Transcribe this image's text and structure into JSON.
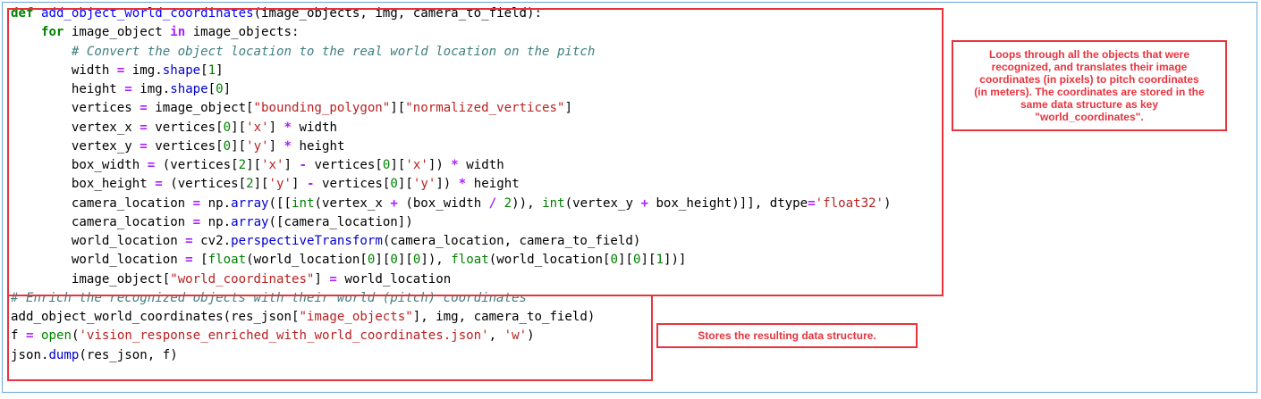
{
  "code_lines": [
    [
      {
        "t": "def",
        "c": "kw"
      },
      {
        "t": " "
      },
      {
        "t": "add_object_world_coordinates",
        "c": "fn"
      },
      {
        "t": "(image_objects, img, camera_to_field):"
      }
    ],
    [
      {
        "t": "    "
      },
      {
        "t": "for",
        "c": "kw"
      },
      {
        "t": " image_object "
      },
      {
        "t": "in",
        "c": "op"
      },
      {
        "t": " image_objects:"
      }
    ],
    [
      {
        "t": "        "
      },
      {
        "t": "# Convert the object location to the real world location on the pitch",
        "c": "cm"
      }
    ],
    [
      {
        "t": "        width "
      },
      {
        "t": "=",
        "c": "op"
      },
      {
        "t": " img."
      },
      {
        "t": "shape",
        "c": "attr"
      },
      {
        "t": "["
      },
      {
        "t": "1",
        "c": "nm"
      },
      {
        "t": "]"
      }
    ],
    [
      {
        "t": "        height "
      },
      {
        "t": "=",
        "c": "op"
      },
      {
        "t": " img."
      },
      {
        "t": "shape",
        "c": "attr"
      },
      {
        "t": "["
      },
      {
        "t": "0",
        "c": "nm"
      },
      {
        "t": "]"
      }
    ],
    [
      {
        "t": "        vertices "
      },
      {
        "t": "=",
        "c": "op"
      },
      {
        "t": " image_object["
      },
      {
        "t": "\"bounding_polygon\"",
        "c": "str"
      },
      {
        "t": "]["
      },
      {
        "t": "\"normalized_vertices\"",
        "c": "str"
      },
      {
        "t": "]"
      }
    ],
    [
      {
        "t": "        vertex_x "
      },
      {
        "t": "=",
        "c": "op"
      },
      {
        "t": " vertices["
      },
      {
        "t": "0",
        "c": "nm"
      },
      {
        "t": "]["
      },
      {
        "t": "'x'",
        "c": "str"
      },
      {
        "t": "] "
      },
      {
        "t": "*",
        "c": "op"
      },
      {
        "t": " width"
      }
    ],
    [
      {
        "t": "        vertex_y "
      },
      {
        "t": "=",
        "c": "op"
      },
      {
        "t": " vertices["
      },
      {
        "t": "0",
        "c": "nm"
      },
      {
        "t": "]["
      },
      {
        "t": "'y'",
        "c": "str"
      },
      {
        "t": "] "
      },
      {
        "t": "*",
        "c": "op"
      },
      {
        "t": " height"
      }
    ],
    [
      {
        "t": "        box_width "
      },
      {
        "t": "=",
        "c": "op"
      },
      {
        "t": " (vertices["
      },
      {
        "t": "2",
        "c": "nm"
      },
      {
        "t": "]["
      },
      {
        "t": "'x'",
        "c": "str"
      },
      {
        "t": "] "
      },
      {
        "t": "-",
        "c": "op"
      },
      {
        "t": " vertices["
      },
      {
        "t": "0",
        "c": "nm"
      },
      {
        "t": "]["
      },
      {
        "t": "'x'",
        "c": "str"
      },
      {
        "t": "]) "
      },
      {
        "t": "*",
        "c": "op"
      },
      {
        "t": " width"
      }
    ],
    [
      {
        "t": "        box_height "
      },
      {
        "t": "=",
        "c": "op"
      },
      {
        "t": " (vertices["
      },
      {
        "t": "2",
        "c": "nm"
      },
      {
        "t": "]["
      },
      {
        "t": "'y'",
        "c": "str"
      },
      {
        "t": "] "
      },
      {
        "t": "-",
        "c": "op"
      },
      {
        "t": " vertices["
      },
      {
        "t": "0",
        "c": "nm"
      },
      {
        "t": "]["
      },
      {
        "t": "'y'",
        "c": "str"
      },
      {
        "t": "]) "
      },
      {
        "t": "*",
        "c": "op"
      },
      {
        "t": " height"
      }
    ],
    [
      {
        "t": "        camera_location "
      },
      {
        "t": "=",
        "c": "op"
      },
      {
        "t": " np."
      },
      {
        "t": "array",
        "c": "attr"
      },
      {
        "t": "([["
      },
      {
        "t": "int",
        "c": "nm"
      },
      {
        "t": "(vertex_x "
      },
      {
        "t": "+",
        "c": "op"
      },
      {
        "t": " (box_width "
      },
      {
        "t": "/",
        "c": "op"
      },
      {
        "t": " "
      },
      {
        "t": "2",
        "c": "nm"
      },
      {
        "t": ")), "
      },
      {
        "t": "int",
        "c": "nm"
      },
      {
        "t": "(vertex_y "
      },
      {
        "t": "+",
        "c": "op"
      },
      {
        "t": " box_height)]], dtype"
      },
      {
        "t": "=",
        "c": "op"
      },
      {
        "t": "'float32'",
        "c": "str"
      },
      {
        "t": ")"
      }
    ],
    [
      {
        "t": "        camera_location "
      },
      {
        "t": "=",
        "c": "op"
      },
      {
        "t": " np."
      },
      {
        "t": "array",
        "c": "attr"
      },
      {
        "t": "([camera_location])"
      }
    ],
    [
      {
        "t": "        world_location "
      },
      {
        "t": "=",
        "c": "op"
      },
      {
        "t": " cv2."
      },
      {
        "t": "perspectiveTransform",
        "c": "attr"
      },
      {
        "t": "(camera_location, camera_to_field)"
      }
    ],
    [
      {
        "t": "        world_location "
      },
      {
        "t": "=",
        "c": "op"
      },
      {
        "t": " ["
      },
      {
        "t": "float",
        "c": "nm"
      },
      {
        "t": "(world_location["
      },
      {
        "t": "0",
        "c": "nm"
      },
      {
        "t": "]["
      },
      {
        "t": "0",
        "c": "nm"
      },
      {
        "t": "]["
      },
      {
        "t": "0",
        "c": "nm"
      },
      {
        "t": "]), "
      },
      {
        "t": "float",
        "c": "nm"
      },
      {
        "t": "(world_location["
      },
      {
        "t": "0",
        "c": "nm"
      },
      {
        "t": "]["
      },
      {
        "t": "0",
        "c": "nm"
      },
      {
        "t": "]["
      },
      {
        "t": "1",
        "c": "nm"
      },
      {
        "t": "])]"
      }
    ],
    [
      {
        "t": "        image_object["
      },
      {
        "t": "\"world_coordinates\"",
        "c": "str"
      },
      {
        "t": "] "
      },
      {
        "t": "=",
        "c": "op"
      },
      {
        "t": " world_location"
      }
    ],
    [
      {
        "t": "# Enrich the recognized objects with their world (pitch) coordinates",
        "c": "cm"
      }
    ],
    [
      {
        "t": "add_object_world_coordinates(res_json["
      },
      {
        "t": "\"image_objects\"",
        "c": "str"
      },
      {
        "t": "], img, camera_to_field)"
      }
    ],
    [
      {
        "t": "f "
      },
      {
        "t": "=",
        "c": "op"
      },
      {
        "t": " "
      },
      {
        "t": "open",
        "c": "nm"
      },
      {
        "t": "("
      },
      {
        "t": "'vision_response_enriched_with_world_coordinates.json'",
        "c": "str"
      },
      {
        "t": ", "
      },
      {
        "t": "'w'",
        "c": "str"
      },
      {
        "t": ")"
      }
    ],
    [
      {
        "t": "json."
      },
      {
        "t": "dump",
        "c": "attr"
      },
      {
        "t": "(res_json, f)"
      }
    ]
  ],
  "annotations": {
    "loop_note": [
      "Loops through all the objects that were",
      "recognized, and translates their image",
      "coordinates (in pixels) to pitch coordinates",
      "(in meters). The coordinates are stored in the",
      "same data structure as key",
      "\"world_coordinates\"."
    ],
    "store_note": "Stores the resulting data structure."
  },
  "colors": {
    "annotation_red": "#e8333d",
    "cell_border": "#6aa7d8"
  }
}
